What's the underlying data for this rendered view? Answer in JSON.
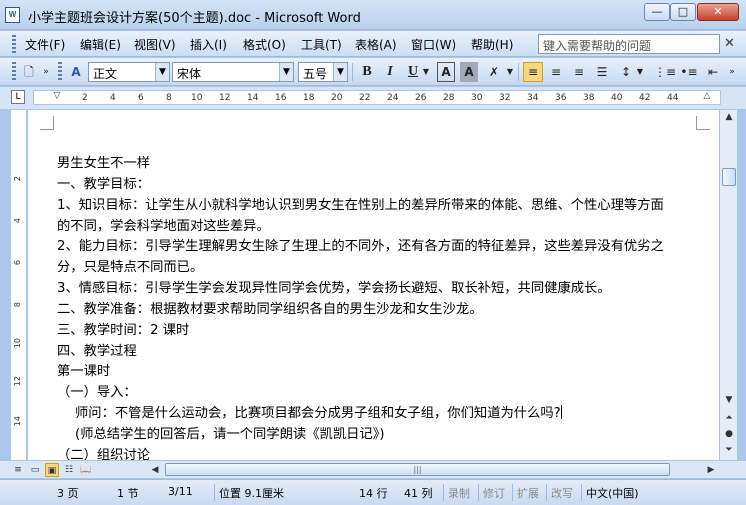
{
  "window": {
    "title": "小学主题班会设计方案(50个主题).doc - Microsoft Word",
    "app_icon": "W",
    "minimize": "—",
    "maximize": "□",
    "close": "✕"
  },
  "menu": {
    "items": [
      "文件(F)",
      "编辑(E)",
      "视图(V)",
      "插入(I)",
      "格式(O)",
      "工具(T)",
      "表格(A)",
      "窗口(W)",
      "帮助(H)"
    ],
    "help_placeholder": "键入需要帮助的问题"
  },
  "toolbar": {
    "style": "正文",
    "font": "宋体",
    "size": "五号",
    "bold": "B",
    "italic": "I",
    "underline": "U"
  },
  "ruler": {
    "ticks": [
      "2",
      "4",
      "6",
      "8",
      "10",
      "12",
      "14",
      "16",
      "18",
      "20",
      "22",
      "24",
      "26",
      "28",
      "30",
      "32",
      "34",
      "36",
      "38",
      "40",
      "42",
      "44"
    ],
    "vticks": [
      "2",
      "4",
      "6",
      "8",
      "10",
      "12",
      "14"
    ]
  },
  "document": {
    "paragraphs": [
      "男生女生不一样",
      "一、教学目标：",
      "1、知识目标：让学生从小就科学地认识到男女生在性别上的差异所带来的体能、思维、个性心理等方面",
      "的不同，学会科学地面对这些差异。",
      "2、能力目标：引导学生理解男女生除了生理上的不同外，还有各方面的特征差异，这些差异没有优劣之",
      "分，只是特点不同而已。",
      "3、情感目标：引导学生学会发现异性同学会优势，学会扬长避短、取长补短，共同健康成长。",
      "二、教学准备：根据教材要求帮助同学组织各自的男生沙龙和女生沙龙。",
      "三、教学时间：2 课时",
      "四、教学过程",
      "第一课时",
      "（一）导入：",
      "师问：不管是什么运动会，比赛项目都会分成男子组和女子组，你们知道为什么吗?",
      "(师总结学生的回答后，请一个同学朗读《凯凯日记》)",
      "（二）组织讨论"
    ]
  },
  "status": {
    "page": "3 页",
    "section": "1 节",
    "page_of": "3/11",
    "position": "位置 9.1厘米",
    "line": "14 行",
    "column": "41 列",
    "rec": "录制",
    "trk": "修订",
    "ext": "扩展",
    "ovr": "改写",
    "language": "中文(中国)"
  }
}
